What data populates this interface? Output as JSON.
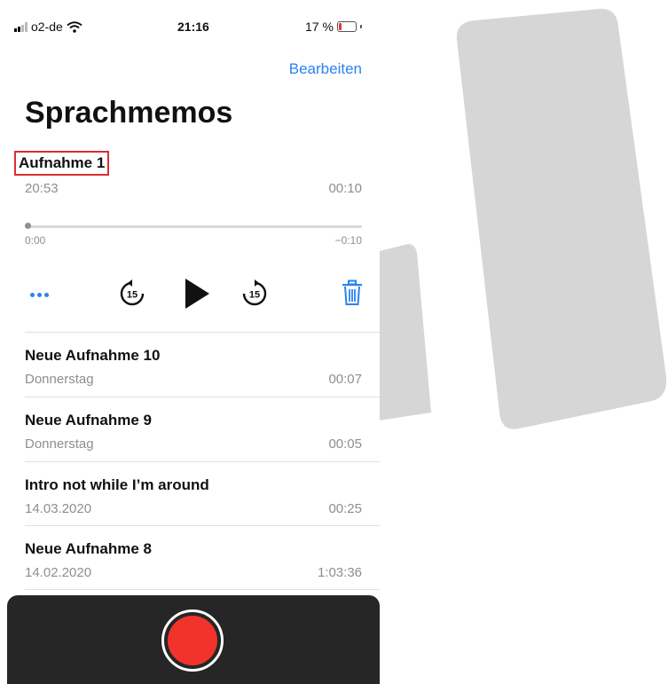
{
  "status_bar": {
    "carrier": "o2-de",
    "time": "21:16",
    "battery": "17 %",
    "battery_level": 0.17
  },
  "header": {
    "edit_label": "Bearbeiten",
    "title": "Sprachmemos"
  },
  "active_recording": {
    "name": "Aufnahme 1",
    "date": "20:53",
    "duration": "00:10",
    "elapsed": "0:00",
    "remaining": "−0:10",
    "progress": 0.0
  },
  "controls": {
    "more": "more-icon",
    "skip_back": "skip-back-15-icon",
    "skip_back_label": "15",
    "play": "play-icon",
    "skip_forward": "skip-forward-15-icon",
    "skip_forward_label": "15",
    "trash": "trash-icon"
  },
  "recordings": [
    {
      "name": "Neue Aufnahme 10",
      "date": "Donnerstag",
      "duration": "00:07"
    },
    {
      "name": "Neue Aufnahme 9",
      "date": "Donnerstag",
      "duration": "00:05"
    },
    {
      "name": "Intro not while I’m around",
      "date": "14.03.2020",
      "duration": "00:25"
    },
    {
      "name": "Neue Aufnahme 8",
      "date": "14.02.2020",
      "duration": "1:03:36"
    }
  ],
  "colors": {
    "accent": "#2a83f2",
    "highlight_border": "#d92f35",
    "record": "#f2332b",
    "record_bar": "#262626",
    "secondary_text": "#8e8e93"
  }
}
